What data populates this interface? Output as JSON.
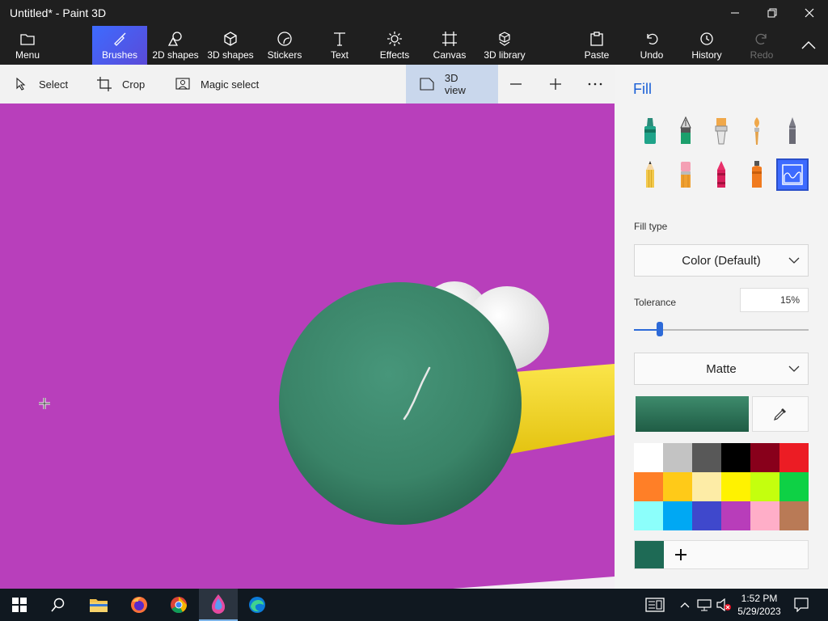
{
  "window": {
    "title": "Untitled* - Paint 3D"
  },
  "ribbon": {
    "menu": "Menu",
    "brushes": "Brushes",
    "shapes2d": "2D shapes",
    "shapes3d": "3D shapes",
    "stickers": "Stickers",
    "text": "Text",
    "effects": "Effects",
    "canvas": "Canvas",
    "library3d": "3D library",
    "paste": "Paste",
    "undo": "Undo",
    "history": "History",
    "redo": "Redo"
  },
  "toolbar": {
    "select": "Select",
    "crop": "Crop",
    "magic_select": "Magic select",
    "view3d": "3D view"
  },
  "panel": {
    "title": "Fill",
    "fill_type_label": "Fill type",
    "fill_type_value": "Color (Default)",
    "tolerance_label": "Tolerance",
    "tolerance_value": "15%",
    "tolerance_level": 0.15,
    "finish_value": "Matte",
    "current_color": "#2a6e56",
    "palette": [
      "#ffffff",
      "#c3c3c3",
      "#585858",
      "#000000",
      "#88001b",
      "#ec1c24",
      "#ff7f27",
      "#ffca18",
      "#fdeca6",
      "#fff200",
      "#c4ff0e",
      "#0ed145",
      "#8cfffb",
      "#00a8f3",
      "#3f48cc",
      "#b83dba",
      "#ffaec8",
      "#b97a56"
    ],
    "custom_color": "#1e6a55"
  },
  "taskbar": {
    "time": "1:52 PM",
    "date": "5/29/2023"
  },
  "colors": {
    "accent": "#3d6bff",
    "canvas_bg": "#b83fbb",
    "sphere_green": "#3e8b6c",
    "cylinder_yellow": "#f5d623"
  }
}
